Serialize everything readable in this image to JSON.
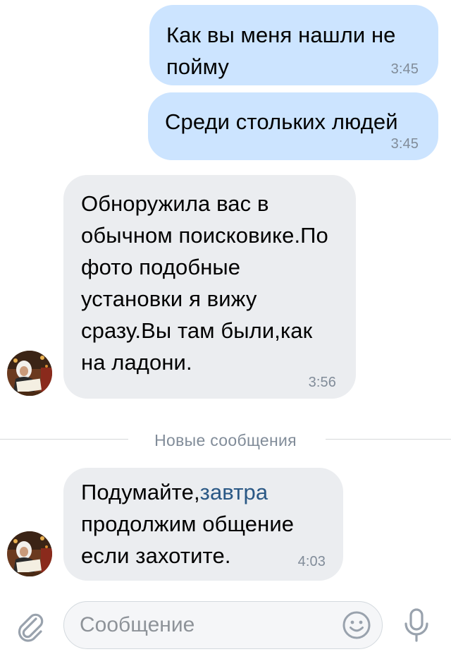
{
  "messages": [
    {
      "direction": "outgoing",
      "text": "Как вы меня нашли не пойму",
      "time": "3:45"
    },
    {
      "direction": "outgoing",
      "text": "Среди стольких людей",
      "time": "3:45"
    },
    {
      "direction": "incoming",
      "text": "Обноружила вас в обычном поисковике.По фото подобные установки я вижу сразу.Вы там были,как на ладони.",
      "time": "3:56",
      "avatar": "sender-avatar"
    },
    {
      "direction": "incoming",
      "text_before_link": "Подумайте,",
      "link_text": "завтра",
      "text_after_link": " продолжим общение если захотите.",
      "time": "4:03",
      "avatar": "sender-avatar"
    }
  ],
  "divider": {
    "label": "Новые сообщения"
  },
  "composer": {
    "placeholder": "Сообщение",
    "value": "",
    "icons": {
      "attach": "paperclip-icon",
      "emoji": "smiley-icon",
      "voice": "microphone-icon"
    }
  },
  "colors": {
    "outgoing_bubble": "#cce4ff",
    "incoming_bubble": "#ebedf0",
    "timestamp": "#818c99",
    "link": "#2a5885",
    "icon": "#99a2ad"
  }
}
